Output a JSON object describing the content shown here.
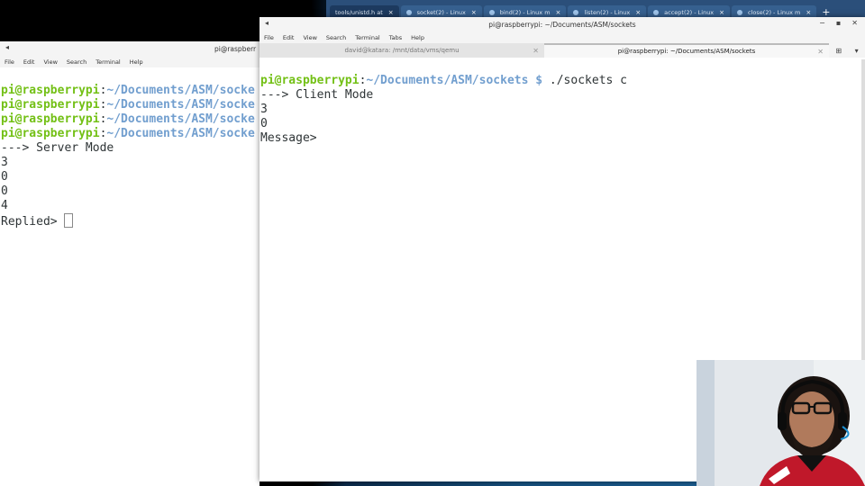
{
  "browser": {
    "tabs": [
      {
        "label": "tools/unistd.h at",
        "active": true
      },
      {
        "label": "socket(2) - Linux",
        "active": false
      },
      {
        "label": "bind(2) - Linux m",
        "active": false
      },
      {
        "label": "listen(2) - Linux",
        "active": false
      },
      {
        "label": "accept(2) - Linux",
        "active": false
      },
      {
        "label": "close(2) - Linux m",
        "active": false
      }
    ],
    "close_glyph": "×",
    "new_tab_glyph": "+"
  },
  "left_terminal": {
    "title": "pi@raspberr",
    "menu": [
      "File",
      "Edit",
      "View",
      "Search",
      "Terminal",
      "Help"
    ],
    "prompt_user": "pi@raspberrypi",
    "prompt_colon": ":",
    "prompt_path": "~/Documents/ASM/socke",
    "output": [
      "---> Server Mode",
      "3",
      "0",
      "0",
      "4"
    ],
    "last_line": "Replied> "
  },
  "right_terminal": {
    "title": "pi@raspberrypi: ~/Documents/ASM/sockets",
    "menu": [
      "File",
      "Edit",
      "View",
      "Search",
      "Terminal",
      "Tabs",
      "Help"
    ],
    "tabs": [
      {
        "label": "david@katara: /mnt/data/vms/qemu",
        "active": false
      },
      {
        "label": "pi@raspberrypi: ~/Documents/ASM/sockets",
        "active": true
      }
    ],
    "prompt_user": "pi@raspberrypi",
    "prompt_colon": ":",
    "prompt_path": "~/Documents/ASM/sockets $",
    "command": " ./sockets c",
    "output": [
      "---> Client Mode",
      "3",
      "0",
      ""
    ],
    "last_line": "Message> "
  },
  "colors": {
    "prompt_user": "#73c016",
    "prompt_path": "#729fcf",
    "terminal_text": "#2e3436",
    "terminal_bg": "#ffffff"
  },
  "icons": {
    "window_menu": "window-menu-icon",
    "minimize": "minimize-icon",
    "maximize": "maximize-icon",
    "close": "close-icon"
  }
}
